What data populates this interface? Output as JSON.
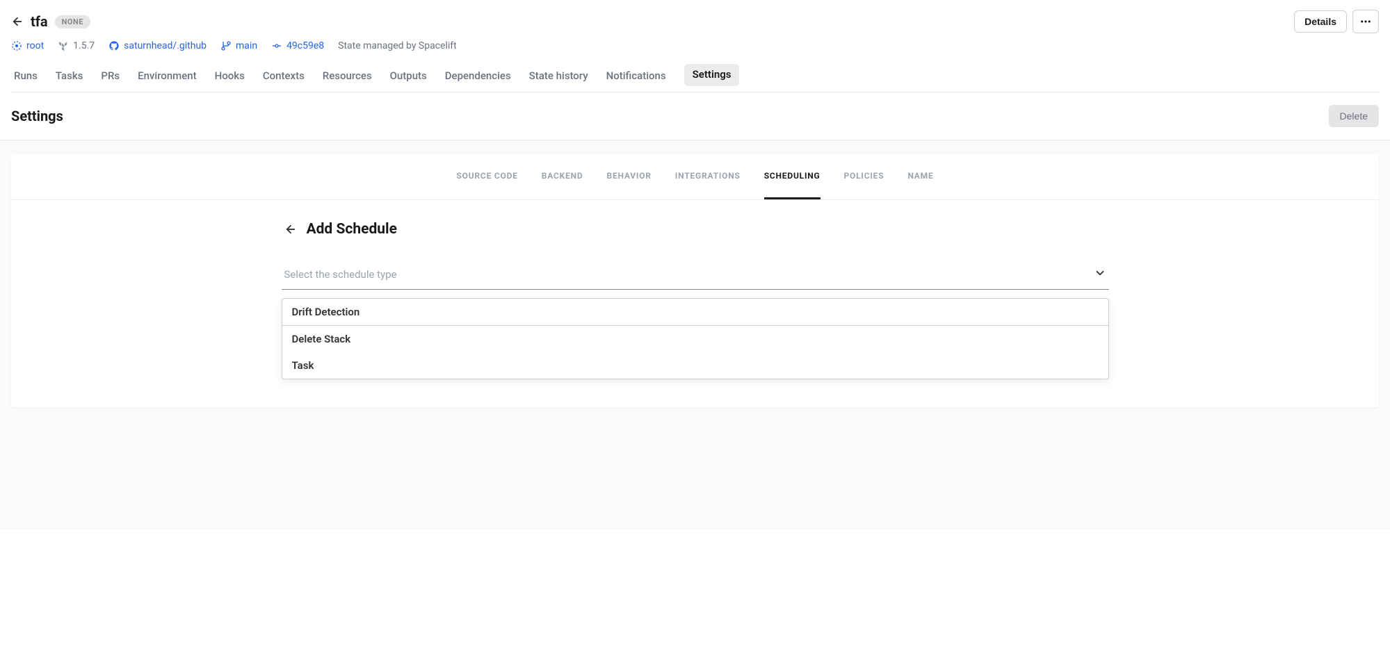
{
  "header": {
    "stack_name": "tfa",
    "badge": "NONE",
    "details_label": "Details"
  },
  "meta": {
    "root": "root",
    "version": "1.5.7",
    "repo": "saturnhead/.github",
    "branch": "main",
    "commit": "49c59e8",
    "state_text": "State managed by Spacelift"
  },
  "nav": {
    "items": [
      "Runs",
      "Tasks",
      "PRs",
      "Environment",
      "Hooks",
      "Contexts",
      "Resources",
      "Outputs",
      "Dependencies",
      "State history",
      "Notifications",
      "Settings"
    ],
    "active_index": 11
  },
  "page": {
    "title": "Settings",
    "delete_label": "Delete"
  },
  "settings_tabs": {
    "items": [
      "SOURCE CODE",
      "BACKEND",
      "BEHAVIOR",
      "INTEGRATIONS",
      "SCHEDULING",
      "POLICIES",
      "NAME"
    ],
    "active_index": 4
  },
  "form": {
    "title": "Add Schedule",
    "select_placeholder": "Select the schedule type",
    "options": [
      "Drift Detection",
      "Delete Stack",
      "Task"
    ]
  }
}
